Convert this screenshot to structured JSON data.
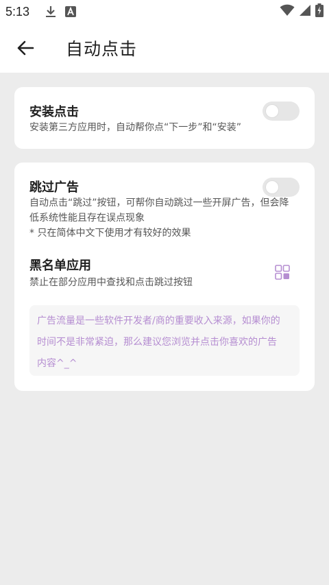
{
  "status_bar": {
    "time": "5:13",
    "icons": [
      "download-icon",
      "text-app-icon",
      "wifi-icon",
      "signal-icon",
      "battery-charging-icon"
    ]
  },
  "app_bar": {
    "title": "自动点击",
    "back_icon": "arrow-left-icon"
  },
  "install_card": {
    "title": "安装点击",
    "description": "安装第三方应用时，自动帮你点“下一步”和“安装”",
    "toggle_on": false
  },
  "skip_ads_card": {
    "title": "跳过广告",
    "description_line1": "自动点击“跳过”按钮，可帮你自动跳过一些开屏广告，但会降",
    "description_line2": "低系统性能且存在误点现象",
    "description_line3": "* 只在简体中文下使用才有较好的效果",
    "toggle_on": false,
    "blacklist": {
      "title": "黑名单应用",
      "description": "禁止在部分应用中查找和点击跳过按钮",
      "icon": "apps-grid-icon"
    },
    "note": {
      "line1": "广告流量是一些软件开发者/商的重要收入来源，如果你的",
      "line2": "时间不是非常紧迫，那么建议您浏览并点击你喜欢的广告",
      "line3": "内容^_^"
    }
  },
  "colors": {
    "background": "#ececec",
    "card": "#ffffff",
    "note_text": "#b58dd1",
    "icon_accent": "#b58dd1"
  }
}
